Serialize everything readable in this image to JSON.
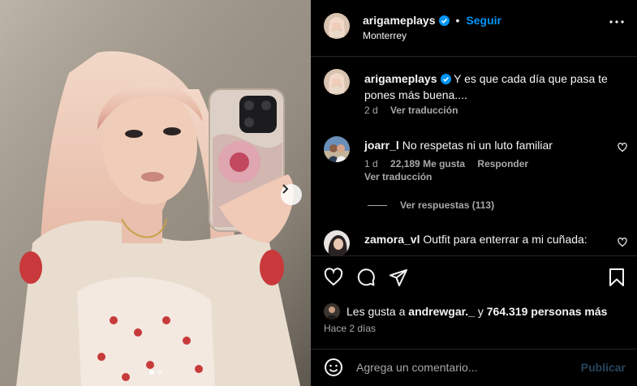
{
  "post": {
    "username": "arigameplays",
    "follow_label": "Seguir",
    "separator": "•",
    "location": "Monterrey"
  },
  "caption": {
    "username": "arigameplays",
    "text": "Y es que cada día que pasa te pones más buena....",
    "age": "2 d",
    "translate": "Ver traducción"
  },
  "comments": [
    {
      "username": "joarr_l",
      "text": "No respetas ni un luto familiar",
      "age": "1 d",
      "likes": "22,189 Me gusta",
      "reply": "Responder",
      "translate": "Ver traducción",
      "replies": "Ver respuestas (113)"
    },
    {
      "username": "zamora_vl",
      "text": "Outfit para enterrar a mi cuñada:"
    }
  ],
  "likes": {
    "prefix": "Les gusta a",
    "user": "andrewgar._",
    "middle": "y",
    "count": "764.319 personas más"
  },
  "time_ago": "Hace 2 días",
  "composer": {
    "placeholder": "Agrega un comentario...",
    "publish": "Publicar"
  },
  "carousel": {
    "current": 1,
    "total": 2
  },
  "colors": {
    "accent": "#0095f6",
    "background": "#000000",
    "muted": "#a8a8a8"
  },
  "icons": [
    "more-icon",
    "heart-icon",
    "comment-icon",
    "share-icon",
    "bookmark-icon",
    "emoji-icon",
    "chevron-right-icon",
    "verified-icon"
  ]
}
